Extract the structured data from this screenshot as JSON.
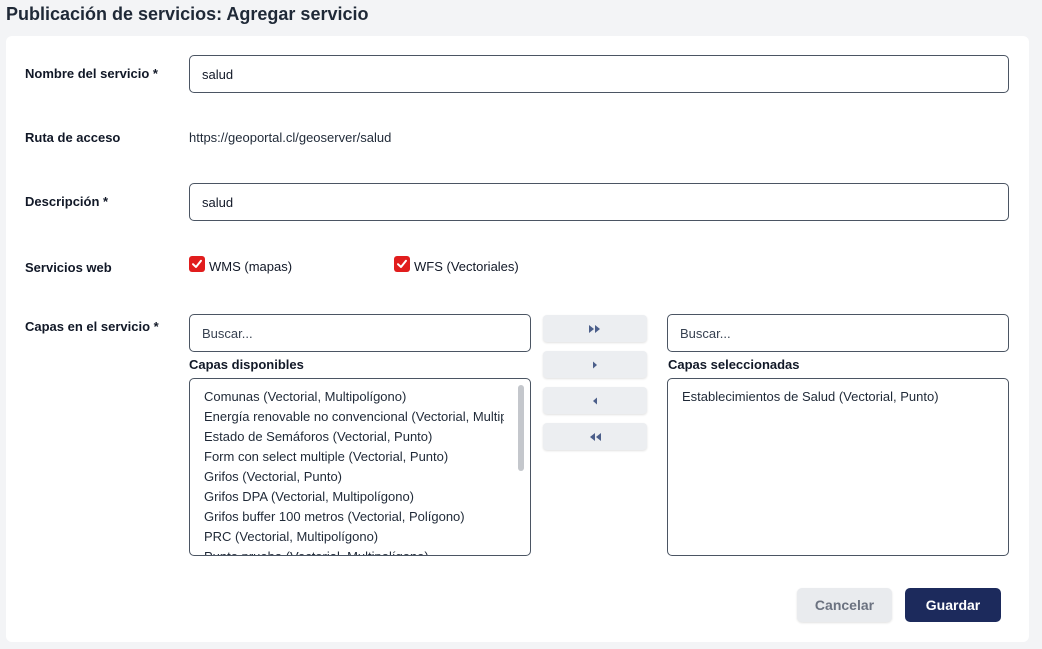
{
  "page": {
    "title": "Publicación de servicios: Agregar servicio"
  },
  "form": {
    "name_label": "Nombre del servicio *",
    "name_value": "salud",
    "path_label": "Ruta de acceso",
    "path_value": "https://geoportal.cl/geoserver/salud",
    "description_label": "Descripción *",
    "description_value": "salud",
    "web_services_label": "Servicios web",
    "wms_label": "WMS (mapas)",
    "wms_checked": true,
    "wfs_label": "WFS (Vectoriales)",
    "wfs_checked": true,
    "layers_label": "Capas en el servicio *"
  },
  "available": {
    "search_placeholder": "Buscar...",
    "title": "Capas disponibles",
    "items": [
      "Comunas (Vectorial, Multipolígono)",
      "Energía renovable no convencional (Vectorial, Multipolígono)",
      "Estado de Semáforos (Vectorial, Punto)",
      "Form con select multiple (Vectorial, Punto)",
      "Grifos (Vectorial, Punto)",
      "Grifos DPA (Vectorial, Multipolígono)",
      "Grifos buffer 100 metros (Vectorial, Polígono)",
      "PRC (Vectorial, Multipolígono)",
      "Punto prueba (Vectorial, Multipolígono)"
    ]
  },
  "selected": {
    "search_placeholder": "Buscar...",
    "title": "Capas seleccionadas",
    "items": [
      "Establecimientos de Salud (Vectorial, Punto)"
    ]
  },
  "actions": {
    "cancel_label": "Cancelar",
    "save_label": "Guardar"
  },
  "colors": {
    "checkbox": "#e11d1d",
    "primary": "#1c2a5c",
    "move_icon": "#4b5e8a"
  }
}
